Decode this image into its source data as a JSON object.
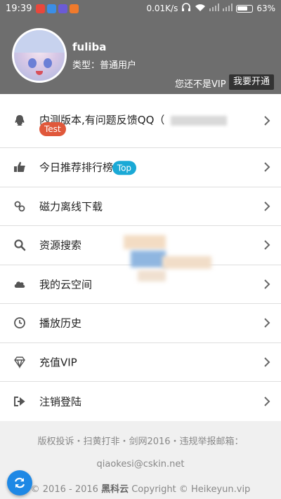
{
  "status_bar": {
    "time": "19:39",
    "network_speed": "0.01K/s",
    "battery": "63%",
    "app_icons": [
      "#e8473c",
      "#3b8ee6",
      "#6b5bd6",
      "#f07a2c"
    ]
  },
  "header": {
    "username": "fuliba",
    "user_type": "类型：普通用户",
    "vip_notice": "您还不是VIP",
    "vip_open_label": "我要开通"
  },
  "menu": {
    "items": [
      {
        "label": "内测版本,有问题反馈QQ（",
        "tag": "Test",
        "icon": "qq-icon"
      },
      {
        "label": "今日推荐排行榜",
        "tag": "Top",
        "icon": "thumbs-up-icon"
      },
      {
        "label": "磁力离线下载",
        "icon": "magnet-link-icon"
      },
      {
        "label": "资源搜索",
        "icon": "search-icon"
      },
      {
        "label": "我的云空间",
        "icon": "cloud-icon"
      },
      {
        "label": "播放历史",
        "icon": "clock-icon"
      },
      {
        "label": "充值VIP",
        "icon": "diamond-icon"
      },
      {
        "label": "注销登陆",
        "icon": "logout-icon"
      }
    ]
  },
  "footer": {
    "line1": "版权投诉・扫黄打非・剑网2016・违规举报邮箱：",
    "email": "qiaokesi@cskin.net",
    "copyright_prefix": "© 2016 - 2016",
    "brand": "黑科云",
    "copyright_suffix": "Copyright © Heikeyun.vip"
  },
  "colors": {
    "header_bg": "#6e6e6e",
    "test_tag": "#e0583b",
    "top_tag": "#1aa9d6",
    "fab": "#1e88e5"
  }
}
